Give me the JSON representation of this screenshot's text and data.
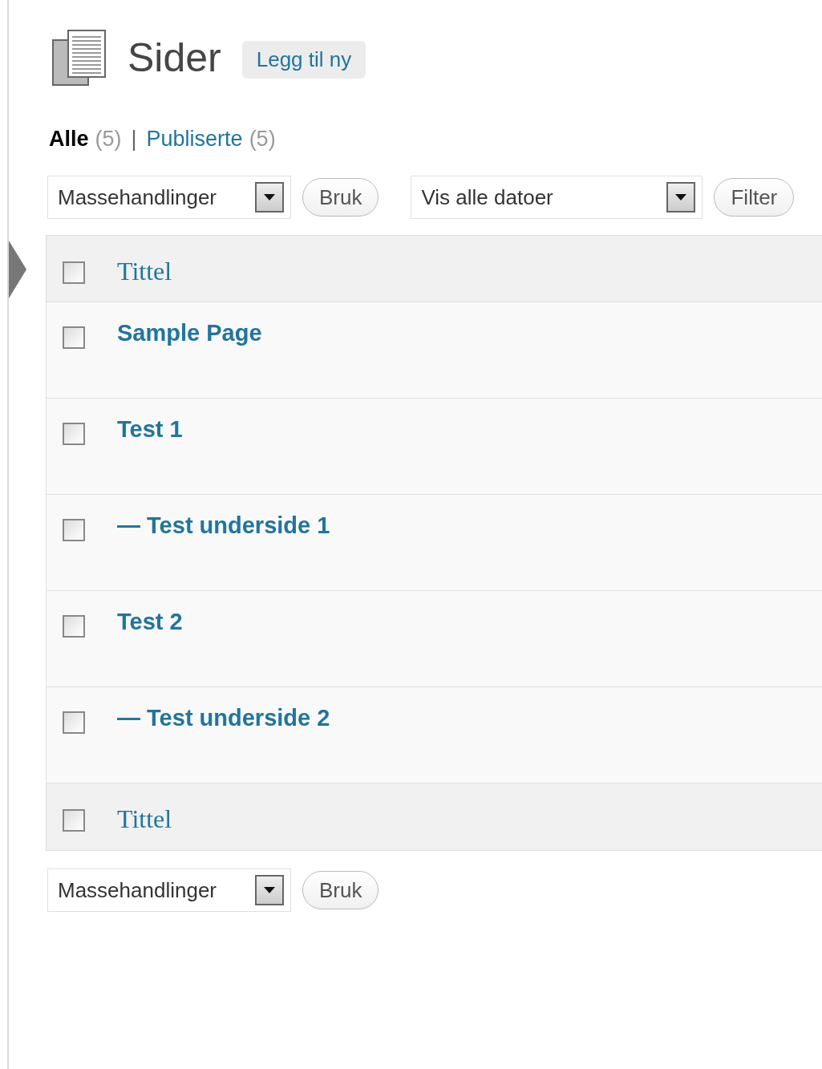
{
  "page": {
    "title": "Sider",
    "add_new": "Legg til ny"
  },
  "views": [
    {
      "label": "Alle",
      "count": "(5)",
      "selected": true
    },
    {
      "label": "Publiserte",
      "count": "(5)",
      "selected": false
    }
  ],
  "view_separator": "|",
  "top_actions": {
    "bulk_select": "Massehandlinger",
    "apply": "Bruk",
    "date_select": "Vis alle datoer",
    "filter": "Filter"
  },
  "table": {
    "header": {
      "label": "Tittel",
      "checked": false
    },
    "rows": [
      {
        "title": "Sample Page",
        "checked": false
      },
      {
        "title": "Test 1",
        "checked": false
      },
      {
        "title": "— Test underside 1",
        "checked": false
      },
      {
        "title": "Test 2",
        "checked": false
      },
      {
        "title": "— Test underside 2",
        "checked": false
      }
    ],
    "footer": {
      "label": "Tittel",
      "checked": false
    }
  },
  "bottom_actions": {
    "bulk_select": "Massehandlinger",
    "apply": "Bruk"
  }
}
